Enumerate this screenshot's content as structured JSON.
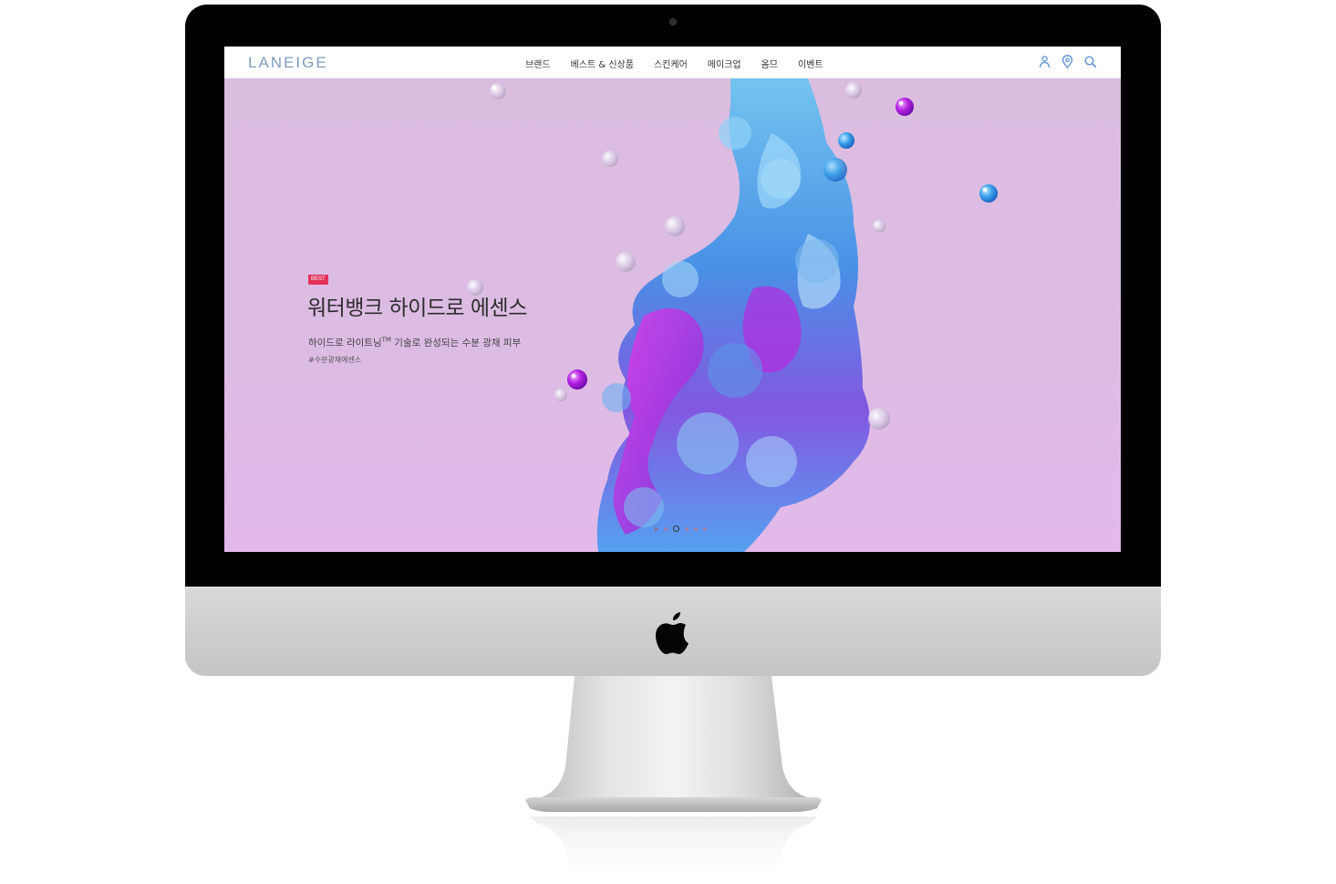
{
  "site": {
    "logo": "LANEIGE",
    "nav": [
      "브랜드",
      "베스트 & 신상품",
      "스킨케어",
      "메이크업",
      "옴므",
      "이벤트"
    ],
    "utility_icons": [
      "user-icon",
      "location-pin-icon",
      "search-icon"
    ],
    "accent_color": "#7f9cc2"
  },
  "hero": {
    "badge": "BEST",
    "headline": "워터뱅크 하이드로 에센스",
    "subline_before": "하이드로 라이트닝",
    "subline_sup": "TM",
    "subline_after": " 기술로 완성되는 수분 광채 피부",
    "hashtag": "#수분광채에센스",
    "background_color": "#dbbde0",
    "badge_color": "#e2315b",
    "slides_total": 5,
    "active_slide": 1
  }
}
